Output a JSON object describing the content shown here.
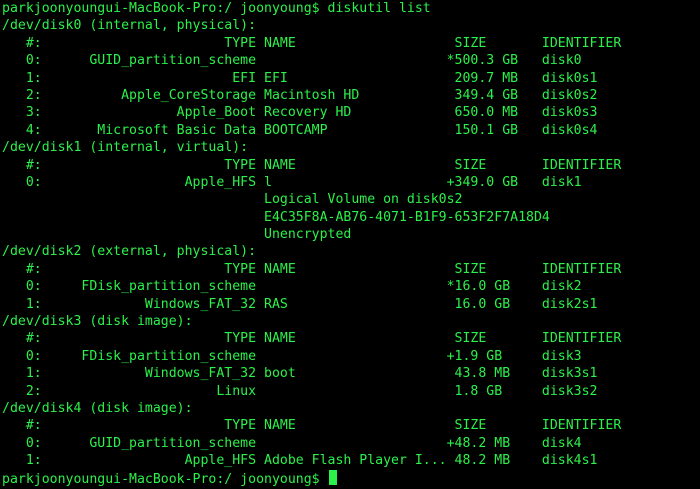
{
  "colors": {
    "background": "#000000",
    "text": "#2cf14a"
  },
  "lines": [
    "parkjoonyoungui-MacBook-Pro:/ joonyoung$ diskutil list",
    "/dev/disk0 (internal, physical):",
    "   #:                       TYPE NAME                    SIZE       IDENTIFIER",
    "   0:      GUID_partition_scheme                        *500.3 GB   disk0",
    "   1:                        EFI EFI                     209.7 MB   disk0s1",
    "   2:          Apple_CoreStorage Macintosh HD            349.4 GB   disk0s2",
    "   3:                 Apple_Boot Recovery HD             650.0 MB   disk0s3",
    "   4:       Microsoft Basic Data BOOTCAMP                150.1 GB   disk0s4",
    "/dev/disk1 (internal, virtual):",
    "   #:                       TYPE NAME                    SIZE       IDENTIFIER",
    "   0:                  Apple_HFS l                      +349.0 GB   disk1",
    "                                 Logical Volume on disk0s2",
    "                                 E4C35F8A-AB76-4071-B1F9-653F2F7A18D4",
    "                                 Unencrypted",
    "/dev/disk2 (external, physical):",
    "   #:                       TYPE NAME                    SIZE       IDENTIFIER",
    "   0:     FDisk_partition_scheme                        *16.0 GB    disk2",
    "   1:             Windows_FAT_32 RAS                     16.0 GB    disk2s1",
    "/dev/disk3 (disk image):",
    "   #:                       TYPE NAME                    SIZE       IDENTIFIER",
    "   0:     FDisk_partition_scheme                        +1.9 GB     disk3",
    "   1:             Windows_FAT_32 boot                    43.8 MB    disk3s1",
    "   2:                      Linux                         1.8 GB     disk3s2",
    "/dev/disk4 (disk image):",
    "   #:                       TYPE NAME                    SIZE       IDENTIFIER",
    "   0:      GUID_partition_scheme                        +48.2 MB    disk4",
    "   1:                  Apple_HFS Adobe Flash Player I... 48.2 MB    disk4s1"
  ],
  "prompt": "parkjoonyoungui-MacBook-Pro:/ joonyoung$ "
}
